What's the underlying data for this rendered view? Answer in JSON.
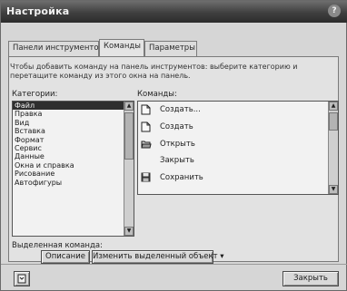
{
  "window": {
    "title": "Настройка",
    "help_label": "?"
  },
  "tabs": [
    {
      "label": "Панели инструментов",
      "active": false
    },
    {
      "label": "Команды",
      "active": true
    },
    {
      "label": "Параметры",
      "active": false
    }
  ],
  "instructions": "Чтобы добавить команду на панель инструментов: выберите категорию и перетащите команду из этого окна на панель.",
  "categories": {
    "label": "Категории:",
    "items": [
      "Файл",
      "Правка",
      "Вид",
      "Вставка",
      "Формат",
      "Сервис",
      "Данные",
      "Окна и справка",
      "Рисование",
      "Автофигуры"
    ],
    "selected_index": 0
  },
  "commands": {
    "label": "Команды:",
    "items": [
      {
        "label": "Создать...",
        "icon": "new-document-icon"
      },
      {
        "label": "Создать",
        "icon": "new-document-icon"
      },
      {
        "label": "Открыть",
        "icon": "open-folder-icon"
      },
      {
        "label": "Закрыть",
        "icon": ""
      },
      {
        "label": "Сохранить",
        "icon": "save-disk-icon"
      }
    ]
  },
  "selected_command": {
    "label": "Выделенная команда:",
    "description_button": "Описание",
    "modify_button": "Изменить выделенный объект"
  },
  "footer": {
    "close_button": "Закрыть",
    "help_icon": "keyboard-help-icon"
  }
}
